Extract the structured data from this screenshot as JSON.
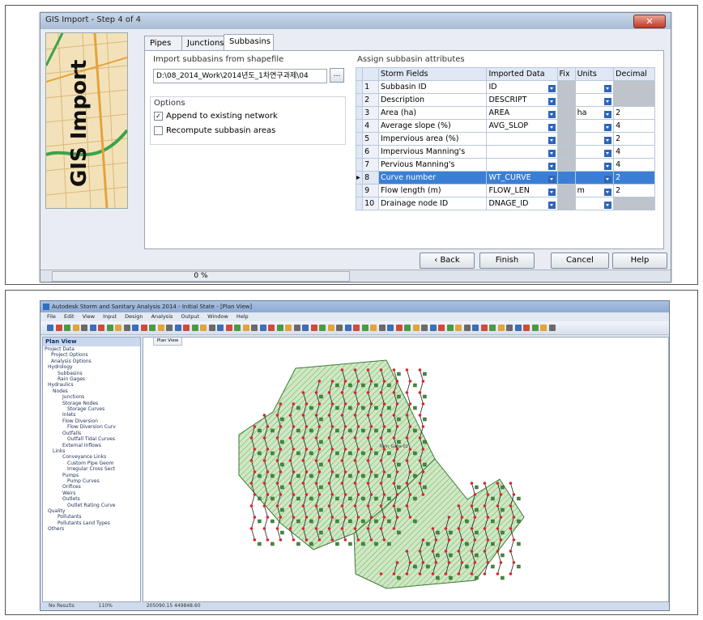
{
  "dialog": {
    "title": "GIS Import - Step 4 of 4",
    "close_label": "✕",
    "banner_text": "GIS Import",
    "tabs": [
      "Pipes",
      "Junctions",
      "Subbasins"
    ],
    "import_label": "Import subbasins from shapefile",
    "path_value": "D:\\08_2014_Work\\2014년도_1차연구과제\\04",
    "browse_label": "...",
    "options_label": "Options",
    "options": [
      {
        "label": "Append to existing network",
        "checked": true
      },
      {
        "label": "Recompute subbasin areas",
        "checked": false
      }
    ],
    "assign_label": "Assign subbasin attributes",
    "grid_headers": [
      "Storm Fields",
      "Imported Data",
      "Fix",
      "Units",
      "Decimal"
    ],
    "rows": [
      {
        "n": "1",
        "field": "Subbasin ID",
        "data": "ID",
        "units": "",
        "decimal": ""
      },
      {
        "n": "2",
        "field": "Description",
        "data": "DESCRIPT",
        "units": "",
        "decimal": ""
      },
      {
        "n": "3",
        "field": "Area (ha)",
        "data": "AREA",
        "units": "ha",
        "decimal": "2"
      },
      {
        "n": "4",
        "field": "Average slope (%)",
        "data": "AVG_SLOP",
        "units": "",
        "decimal": "4"
      },
      {
        "n": "5",
        "field": "Impervious area (%)",
        "data": "",
        "units": "",
        "decimal": "2"
      },
      {
        "n": "6",
        "field": "Impervious Manning's",
        "data": "",
        "units": "",
        "decimal": "4"
      },
      {
        "n": "7",
        "field": "Pervious Manning's",
        "data": "",
        "units": "",
        "decimal": "4"
      },
      {
        "n": "8",
        "field": "Curve number",
        "data": "WT_CURVE",
        "units": "",
        "decimal": "2"
      },
      {
        "n": "9",
        "field": "Flow length (m)",
        "data": "FLOW_LEN",
        "units": "m",
        "decimal": "2"
      },
      {
        "n": "10",
        "field": "Drainage node ID",
        "data": "DNAGE_ID",
        "units": "",
        "decimal": ""
      }
    ],
    "buttons": {
      "back": "‹ Back",
      "finish": "Finish",
      "cancel": "Cancel",
      "help": "Help"
    },
    "progress": "0 %"
  },
  "app": {
    "title": "Autodesk Storm and Sanitary Analysis 2014 - Initial State - [Plan View]",
    "menu": [
      "File",
      "Edit",
      "View",
      "Input",
      "Design",
      "Analysis",
      "Output",
      "Window",
      "Help"
    ],
    "panel_title": "Plan View",
    "map_tab": "Plan View",
    "tree": [
      "Project Data",
      "Project Options",
      "Analysis Options",
      "Hydrology",
      "Subbasins",
      "Rain Gages",
      "Hydraulics",
      "Nodes",
      "Junctions",
      "Storage Nodes",
      "Storage Curves",
      "Inlets",
      "Flow Diversion",
      "Flow Diversion Curv",
      "Outfalls",
      "Outfall Tidal Curves",
      "External Inflows",
      "Links",
      "Conveyance Links",
      "Custom Pipe Geom",
      "Irregular Cross Sect",
      "Pumps",
      "Pump Curves",
      "Orifices",
      "Weirs",
      "Outlets",
      "Outlet Rating Curve",
      "Quality",
      "Pollutants",
      "Pollutants Land Types",
      "Others"
    ],
    "map_label": "Rain_Gage-01",
    "status": [
      "No Results",
      "110%",
      "205090.15  449848.60"
    ]
  }
}
